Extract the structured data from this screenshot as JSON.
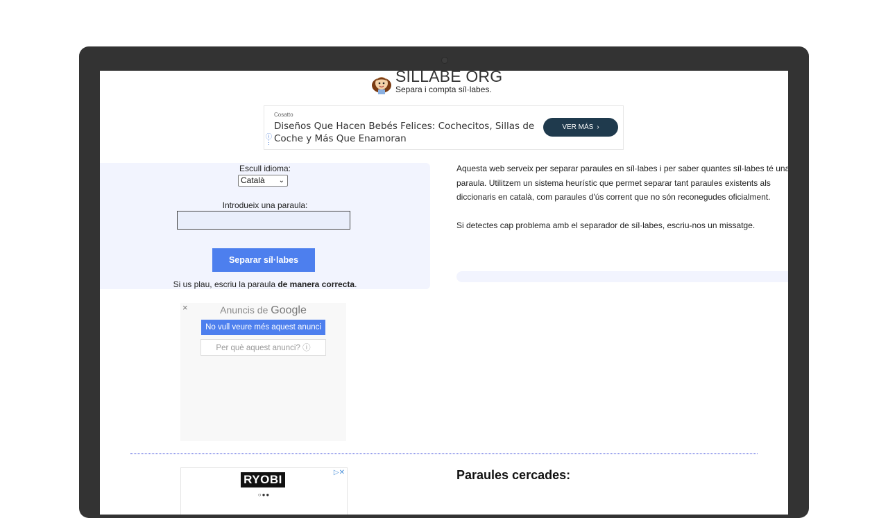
{
  "header": {
    "title": "SILLABE ORG",
    "subtitle": "Separa i compta síl·labes."
  },
  "ad_top": {
    "brand": "Cosatto",
    "text": "Diseños Que Hacen Bebés Felices: Cochecitos, Sillas de Coche y Más Que Enamoran",
    "button": "VER MÁS",
    "info_icon": "info-icon"
  },
  "form": {
    "lang_label": "Escull idioma:",
    "lang_selected": "Català",
    "word_label": "Introdueix una paraula:",
    "word_value": "",
    "submit": "Separar síl·labes",
    "hint_prefix": "Si us plau, escriu la paraula ",
    "hint_bold": "de manera correcta",
    "hint_suffix": "."
  },
  "google_ad": {
    "title_prefix": "Anuncis de ",
    "title_brand": "Google",
    "hide_button": "No vull veure més aquest anunci",
    "why_button": "Per què aquest anunci? ⓘ"
  },
  "about": {
    "paragraph1": "Aquesta web serveix per separar paraules en síl·labes i per saber quantes síl·labes té una paraula. Utilitzem un sistema heurístic que permet separar tant paraules existents als diccionaris en català, com paraules d'ús corrent que no són reconegudes oficialment.",
    "paragraph2": "Si detectes cap problema amb el separador de síl·labes, escriu-nos un missatge."
  },
  "ad_bottom": {
    "brand": "RYOBI",
    "dots": "○●●"
  },
  "searched_words": {
    "heading": "Paraules cercades:"
  },
  "colors": {
    "accent": "#4d7fee",
    "panel_bg": "#f2f4fe",
    "laptop_frame": "#333333"
  }
}
